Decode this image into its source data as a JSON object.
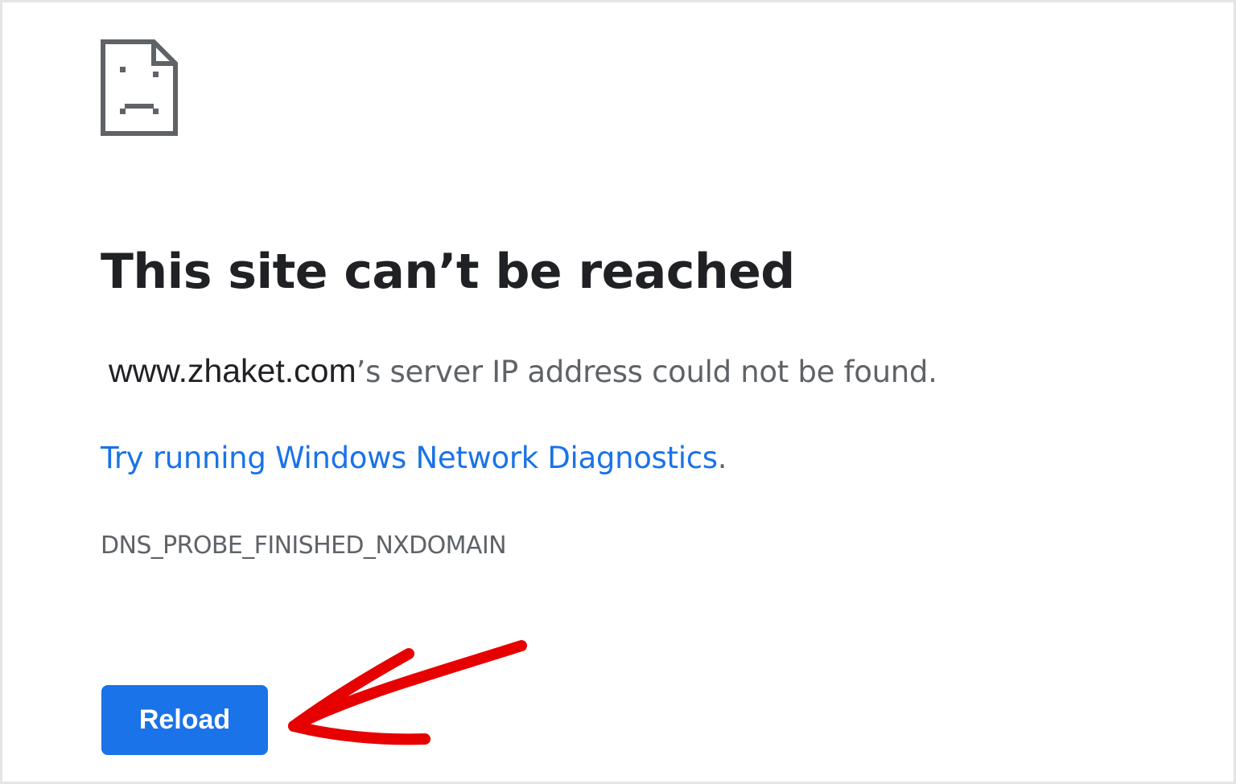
{
  "error_page": {
    "icon": "sad-page-icon",
    "headline": "This site can’t be reached",
    "host": "www.zhaket.com",
    "message_suffix": "’s server IP address could not be found.",
    "diagnostics_prefix": "",
    "diagnostics_link": "Try running Windows Network Diagnostics",
    "diagnostics_suffix": ".",
    "error_code": "DNS_PROBE_FINISHED_NXDOMAIN",
    "reload_label": "Reload"
  },
  "annotation": {
    "icon": "red-arrow-icon",
    "color": "#e60000"
  },
  "colors": {
    "primary_text": "#202124",
    "secondary_text": "#5f6368",
    "link": "#1a73e8",
    "button_bg": "#1a73e8",
    "button_text": "#ffffff"
  }
}
